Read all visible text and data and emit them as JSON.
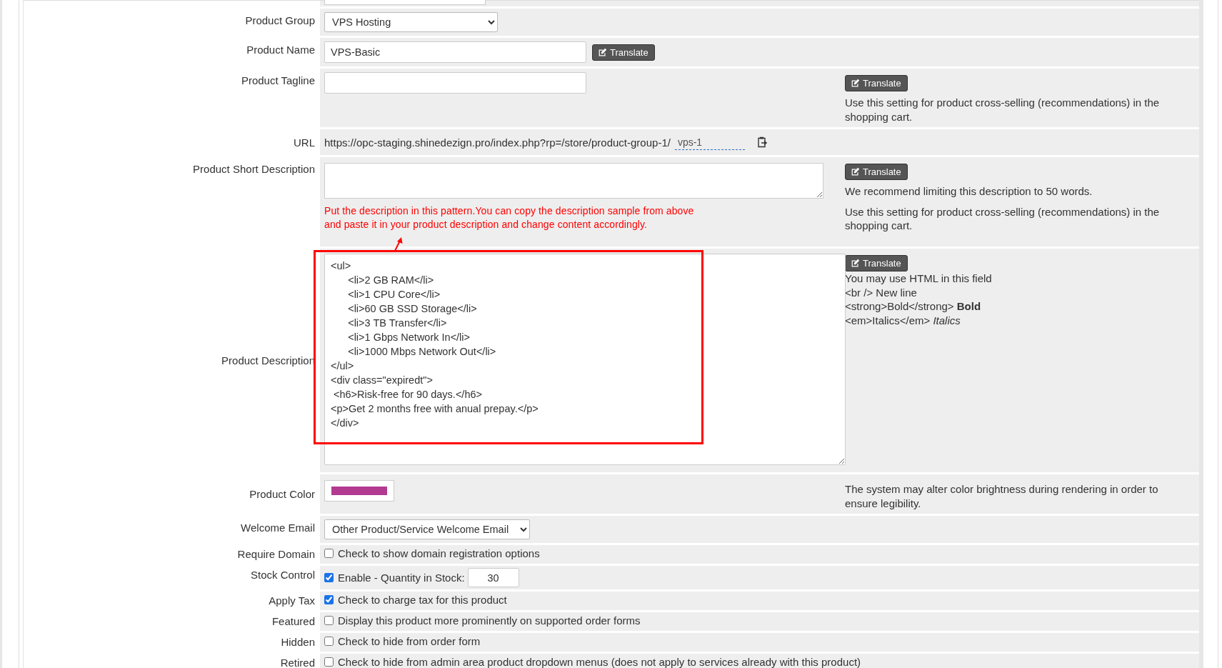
{
  "rows": [
    {
      "kind": "cut"
    },
    {
      "kind": "select",
      "label": "Product Group",
      "value": "VPS Hosting"
    },
    {
      "kind": "text",
      "label": "Product Name",
      "value": "VPS-Basic",
      "inline_button": "Translate"
    },
    {
      "kind": "text",
      "label": "Product Tagline",
      "value": "",
      "help": {
        "button": "Translate",
        "notes": [
          "Use this setting for product cross-selling (recommendations) in the shopping cart."
        ]
      }
    },
    {
      "kind": "url",
      "label": "URL",
      "prefix": "https://opc-staging.shinedezign.pro/index.php?rp=/store/product-group-1/",
      "slug": "vps-1"
    },
    {
      "kind": "textarea",
      "label": "Product Short Description",
      "value": "",
      "note": "Put the description in this pattern.You can copy the description sample from above and paste it in your product description and change content accordingly.",
      "help": {
        "button": "Translate",
        "notes": [
          "We recommend limiting this description to 50 words.",
          "Use this setting for product cross-selling (recommendations) in the shopping cart."
        ]
      }
    },
    {
      "kind": "code",
      "label": "Product Description",
      "value": "<ul>\n\t<li>2 GB RAM</li>\n\t<li>1 CPU Core</li>\n\t<li>60 GB SSD Storage</li>\n\t<li>3 TB Transfer</li>\n\t<li>1 Gbps Network In</li>\n\t<li>1000 Mbps Network Out</li>\n</ul>\n<div class=\"expiredt\">\n <h6>Risk-free for 90 days.</h6>\n<p>Get 2 months free with anual prepay.</p>\n</div>",
      "highlighted": true,
      "help": {
        "button": "Translate",
        "notes": [
          "You may use HTML in this field",
          "<br /> New line",
          "<strong>Bold</strong> **Bold**",
          "<em>Italics</em> *Italics*"
        ]
      }
    },
    {
      "kind": "color",
      "label": "Product Color",
      "color": "#b23a91",
      "help": {
        "notes": [
          "The system may alter color brightness during rendering in order to ensure legibility."
        ]
      }
    },
    {
      "kind": "select",
      "label": "Welcome Email",
      "value": "Other Product/Service Welcome Email",
      "wide": true
    },
    {
      "kind": "checkbox",
      "label": "Require Domain",
      "checked": false,
      "text": "Check to show domain registration options"
    },
    {
      "kind": "stock",
      "label": "Stock Control",
      "checked": true,
      "text": "Enable - Quantity in Stock:",
      "quantity": "30"
    },
    {
      "kind": "checkbox",
      "label": "Apply Tax",
      "checked": true,
      "text": "Check to charge tax for this product"
    },
    {
      "kind": "checkbox",
      "label": "Featured",
      "checked": false,
      "text": "Display this product more prominently on supported order forms"
    },
    {
      "kind": "checkbox",
      "label": "Hidden",
      "checked": false,
      "text": "Check to hide from order form"
    },
    {
      "kind": "checkbox",
      "label": "Retired",
      "checked": false,
      "text": "Check to hide from admin area product dropdown menus (does not apply to services already with this product)"
    }
  ]
}
